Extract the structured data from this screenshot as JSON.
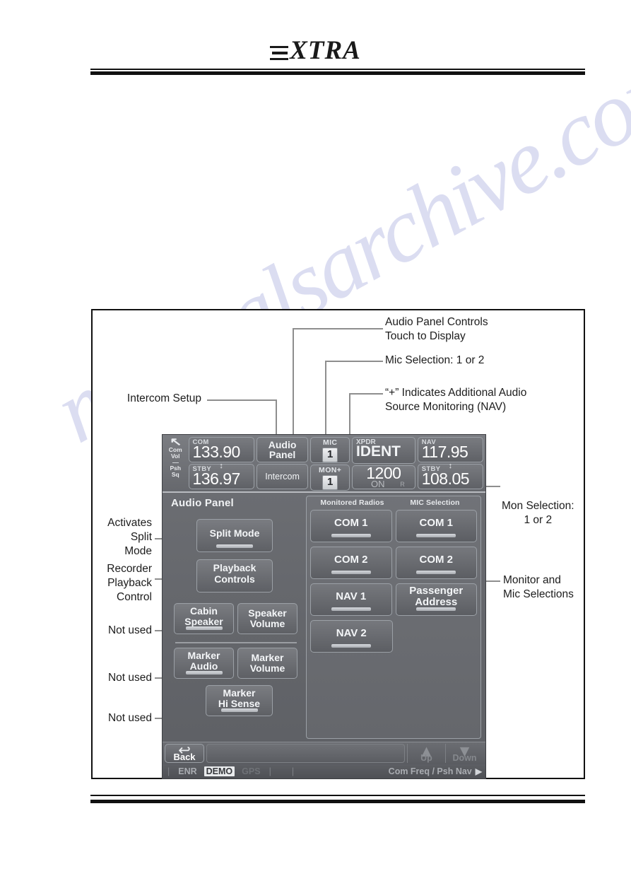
{
  "page": {
    "brand": "EXTRA",
    "brand_suffix": "XTRA"
  },
  "watermark": "manualsarchive.com",
  "callouts": {
    "audio_panel_controls": "Audio Panel Controls\nTouch to Display",
    "audio_panel_controls_l1": "Audio Panel Controls",
    "audio_panel_controls_l2": "Touch to Display",
    "mic_selection": "Mic Selection: 1 or 2",
    "plus_indicates_l1": "“+” Indicates Additional Audio",
    "plus_indicates_l2": "Source Monitoring (NAV)",
    "intercom_setup": "Intercom Setup",
    "activates_split_mode_l1": "Activates",
    "activates_split_mode_l2": "Split",
    "activates_split_mode_l3": "Mode",
    "recorder_playback_l1": "Recorder",
    "recorder_playback_l2": "Playback",
    "recorder_playback_l3": "Control",
    "not_used_1": "Not used",
    "not_used_2": "Not used",
    "not_used_3": "Not used",
    "mon_selection_l1": "Mon Selection:",
    "mon_selection_l2": "1 or 2",
    "monitor_mic_l1": "Monitor and",
    "monitor_mic_l2": "Mic Selections"
  },
  "device": {
    "knob": {
      "arrow": "↖",
      "com_vol_l1": "Com",
      "com_vol_l2": "Vol",
      "psh_sq_l1": "Psh",
      "psh_sq_l2": "Sq"
    },
    "com": {
      "active_label": "COM",
      "active_value": "133.90",
      "standby_label": "STBY",
      "standby_value": "136.97",
      "transfer_icon": "↕"
    },
    "audio_panel_button": "Audio\nPanel",
    "audio_panel_button_l1": "Audio",
    "audio_panel_button_l2": "Panel",
    "intercom_button": "Intercom",
    "mic": {
      "label": "MIC",
      "value": "1"
    },
    "mon": {
      "label": "MON",
      "plus": "+",
      "value": "1"
    },
    "xpdr": {
      "label": "XPDR",
      "mode": "IDENT",
      "code": "1200",
      "state": "ON",
      "r_flag": "R"
    },
    "nav": {
      "active_label": "NAV",
      "active_value": "117.95",
      "standby_label": "STBY",
      "standby_value": "108.05",
      "transfer_icon": "↕"
    },
    "pane_title": "Audio Panel",
    "left_buttons": {
      "split_mode": "Split Mode",
      "playback_controls_l1": "Playback",
      "playback_controls_l2": "Controls",
      "cabin_speaker_l1": "Cabin",
      "cabin_speaker_l2": "Speaker",
      "speaker_volume_l1": "Speaker",
      "speaker_volume_l2": "Volume",
      "marker_audio_l1": "Marker",
      "marker_audio_l2": "Audio",
      "marker_volume_l1": "Marker",
      "marker_volume_l2": "Volume",
      "marker_hi_sense_l1": "Marker",
      "marker_hi_sense_l2": "Hi Sense"
    },
    "right_pane": {
      "head_monitored": "Monitored Radios",
      "head_mic": "MIC Selection",
      "rows": [
        {
          "monitored": "COM 1",
          "mic": "COM 1"
        },
        {
          "monitored": "COM 2",
          "mic": "COM 2"
        },
        {
          "monitored": "NAV 1",
          "mic_l1": "Passenger",
          "mic_l2": "Address"
        },
        {
          "monitored": "NAV 2",
          "mic": ""
        }
      ]
    },
    "bottom": {
      "back": "Back",
      "up": "Up",
      "down": "Down",
      "up_icon": "▲",
      "down_icon": "▼",
      "back_icon": "↩"
    },
    "status": {
      "enr": "ENR",
      "demo": "DEMO",
      "gps": "GPS",
      "tick": "|",
      "right": "Com Freq / Psh Nav",
      "play_icon": "▶"
    }
  }
}
